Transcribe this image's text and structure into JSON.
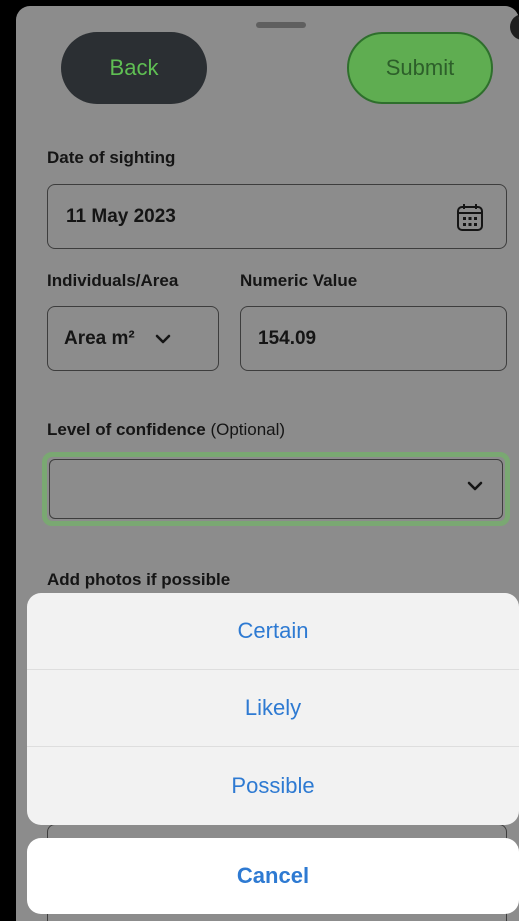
{
  "header": {
    "back_label": "Back",
    "submit_label": "Submit"
  },
  "form": {
    "date_label": "Date of sighting",
    "date_value": "11 May 2023",
    "individuals_label": "Individuals/Area",
    "individuals_value": "Area m²",
    "numeric_label": "Numeric Value",
    "numeric_value": "154.09",
    "confidence_label": "Level of confidence",
    "confidence_optional": "(Optional)",
    "confidence_value": "",
    "photos_label": "Add photos if possible"
  },
  "action_sheet": {
    "options": [
      "Certain",
      "Likely",
      "Possible"
    ],
    "cancel_label": "Cancel"
  },
  "icons": {
    "calendar": "calendar-icon",
    "chevron": "chevron-down-icon"
  },
  "colors": {
    "submit_green": "#5fad51",
    "back_dark": "#2b2f33",
    "action_blue": "#2e7ad2",
    "focus_green": "#7aa872"
  }
}
